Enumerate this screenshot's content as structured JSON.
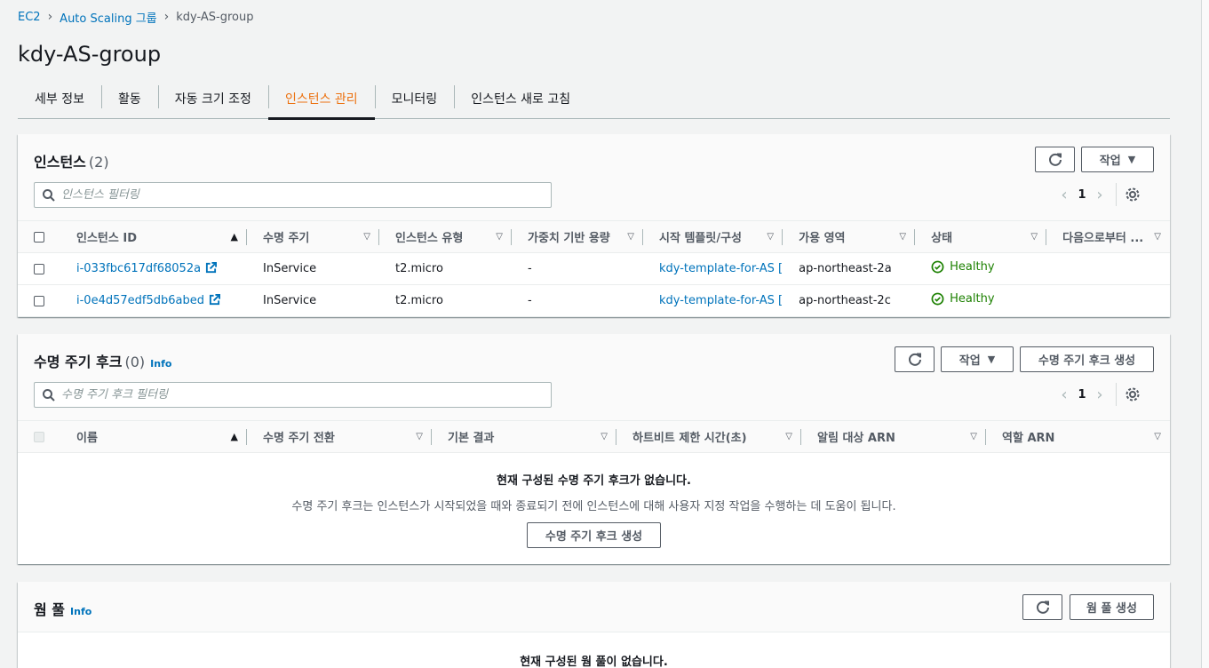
{
  "breadcrumb": {
    "items": [
      "EC2",
      "Auto Scaling 그룹"
    ],
    "current": "kdy-AS-group"
  },
  "page_title": "kdy-AS-group",
  "tabs": [
    {
      "label": "세부 정보"
    },
    {
      "label": "활동"
    },
    {
      "label": "자동 크기 조정"
    },
    {
      "label": "인스턴스 관리",
      "active": true
    },
    {
      "label": "모니터링"
    },
    {
      "label": "인스턴스 새로 고침"
    }
  ],
  "instances": {
    "title": "인스턴스",
    "count": "(2)",
    "actions_label": "작업",
    "filter_placeholder": "인스턴스 필터링",
    "page": "1",
    "columns": [
      "인스턴스 ID",
      "수명 주기",
      "인스턴스 유형",
      "가중치 기반 용량",
      "시작 템플릿/구성",
      "가용 영역",
      "상태",
      "다음으로부터 ..."
    ],
    "rows": [
      {
        "id": "i-033fbc617df68052a",
        "lifecycle": "InService",
        "type": "t2.micro",
        "weight": "-",
        "template": "kdy-template-for-AS",
        "zone": "ap-northeast-2a",
        "status": "Healthy"
      },
      {
        "id": "i-0e4d57edf5db6abed",
        "lifecycle": "InService",
        "type": "t2.micro",
        "weight": "-",
        "template": "kdy-template-for-AS",
        "zone": "ap-northeast-2c",
        "status": "Healthy"
      }
    ]
  },
  "hooks": {
    "title": "수명 주기 후크",
    "count": "(0)",
    "info": "Info",
    "actions_label": "작업",
    "create_label": "수명 주기 후크 생성",
    "filter_placeholder": "수명 주기 후크 필터링",
    "page": "1",
    "columns": [
      "이름",
      "수명 주기 전환",
      "기본 결과",
      "하트비트 제한 시간(초)",
      "알림 대상 ARN",
      "역할 ARN"
    ],
    "empty_title": "현재 구성된 수명 주기 후크가 없습니다.",
    "empty_desc": "수명 주기 후크는 인스턴스가 시작되었을 때와 종료되기 전에 인스턴스에 대해 사용자 지정 작업을 수행하는 데 도움이 됩니다.",
    "empty_button": "수명 주기 후크 생성"
  },
  "warm_pool": {
    "title": "웜 풀",
    "info": "Info",
    "create_label": "웜 풀 생성",
    "empty_title": "현재 구성된 웜 풀이 없습니다."
  },
  "colors": {
    "accent": "#ec7211",
    "link": "#0073bb",
    "healthy": "#1d8102"
  }
}
